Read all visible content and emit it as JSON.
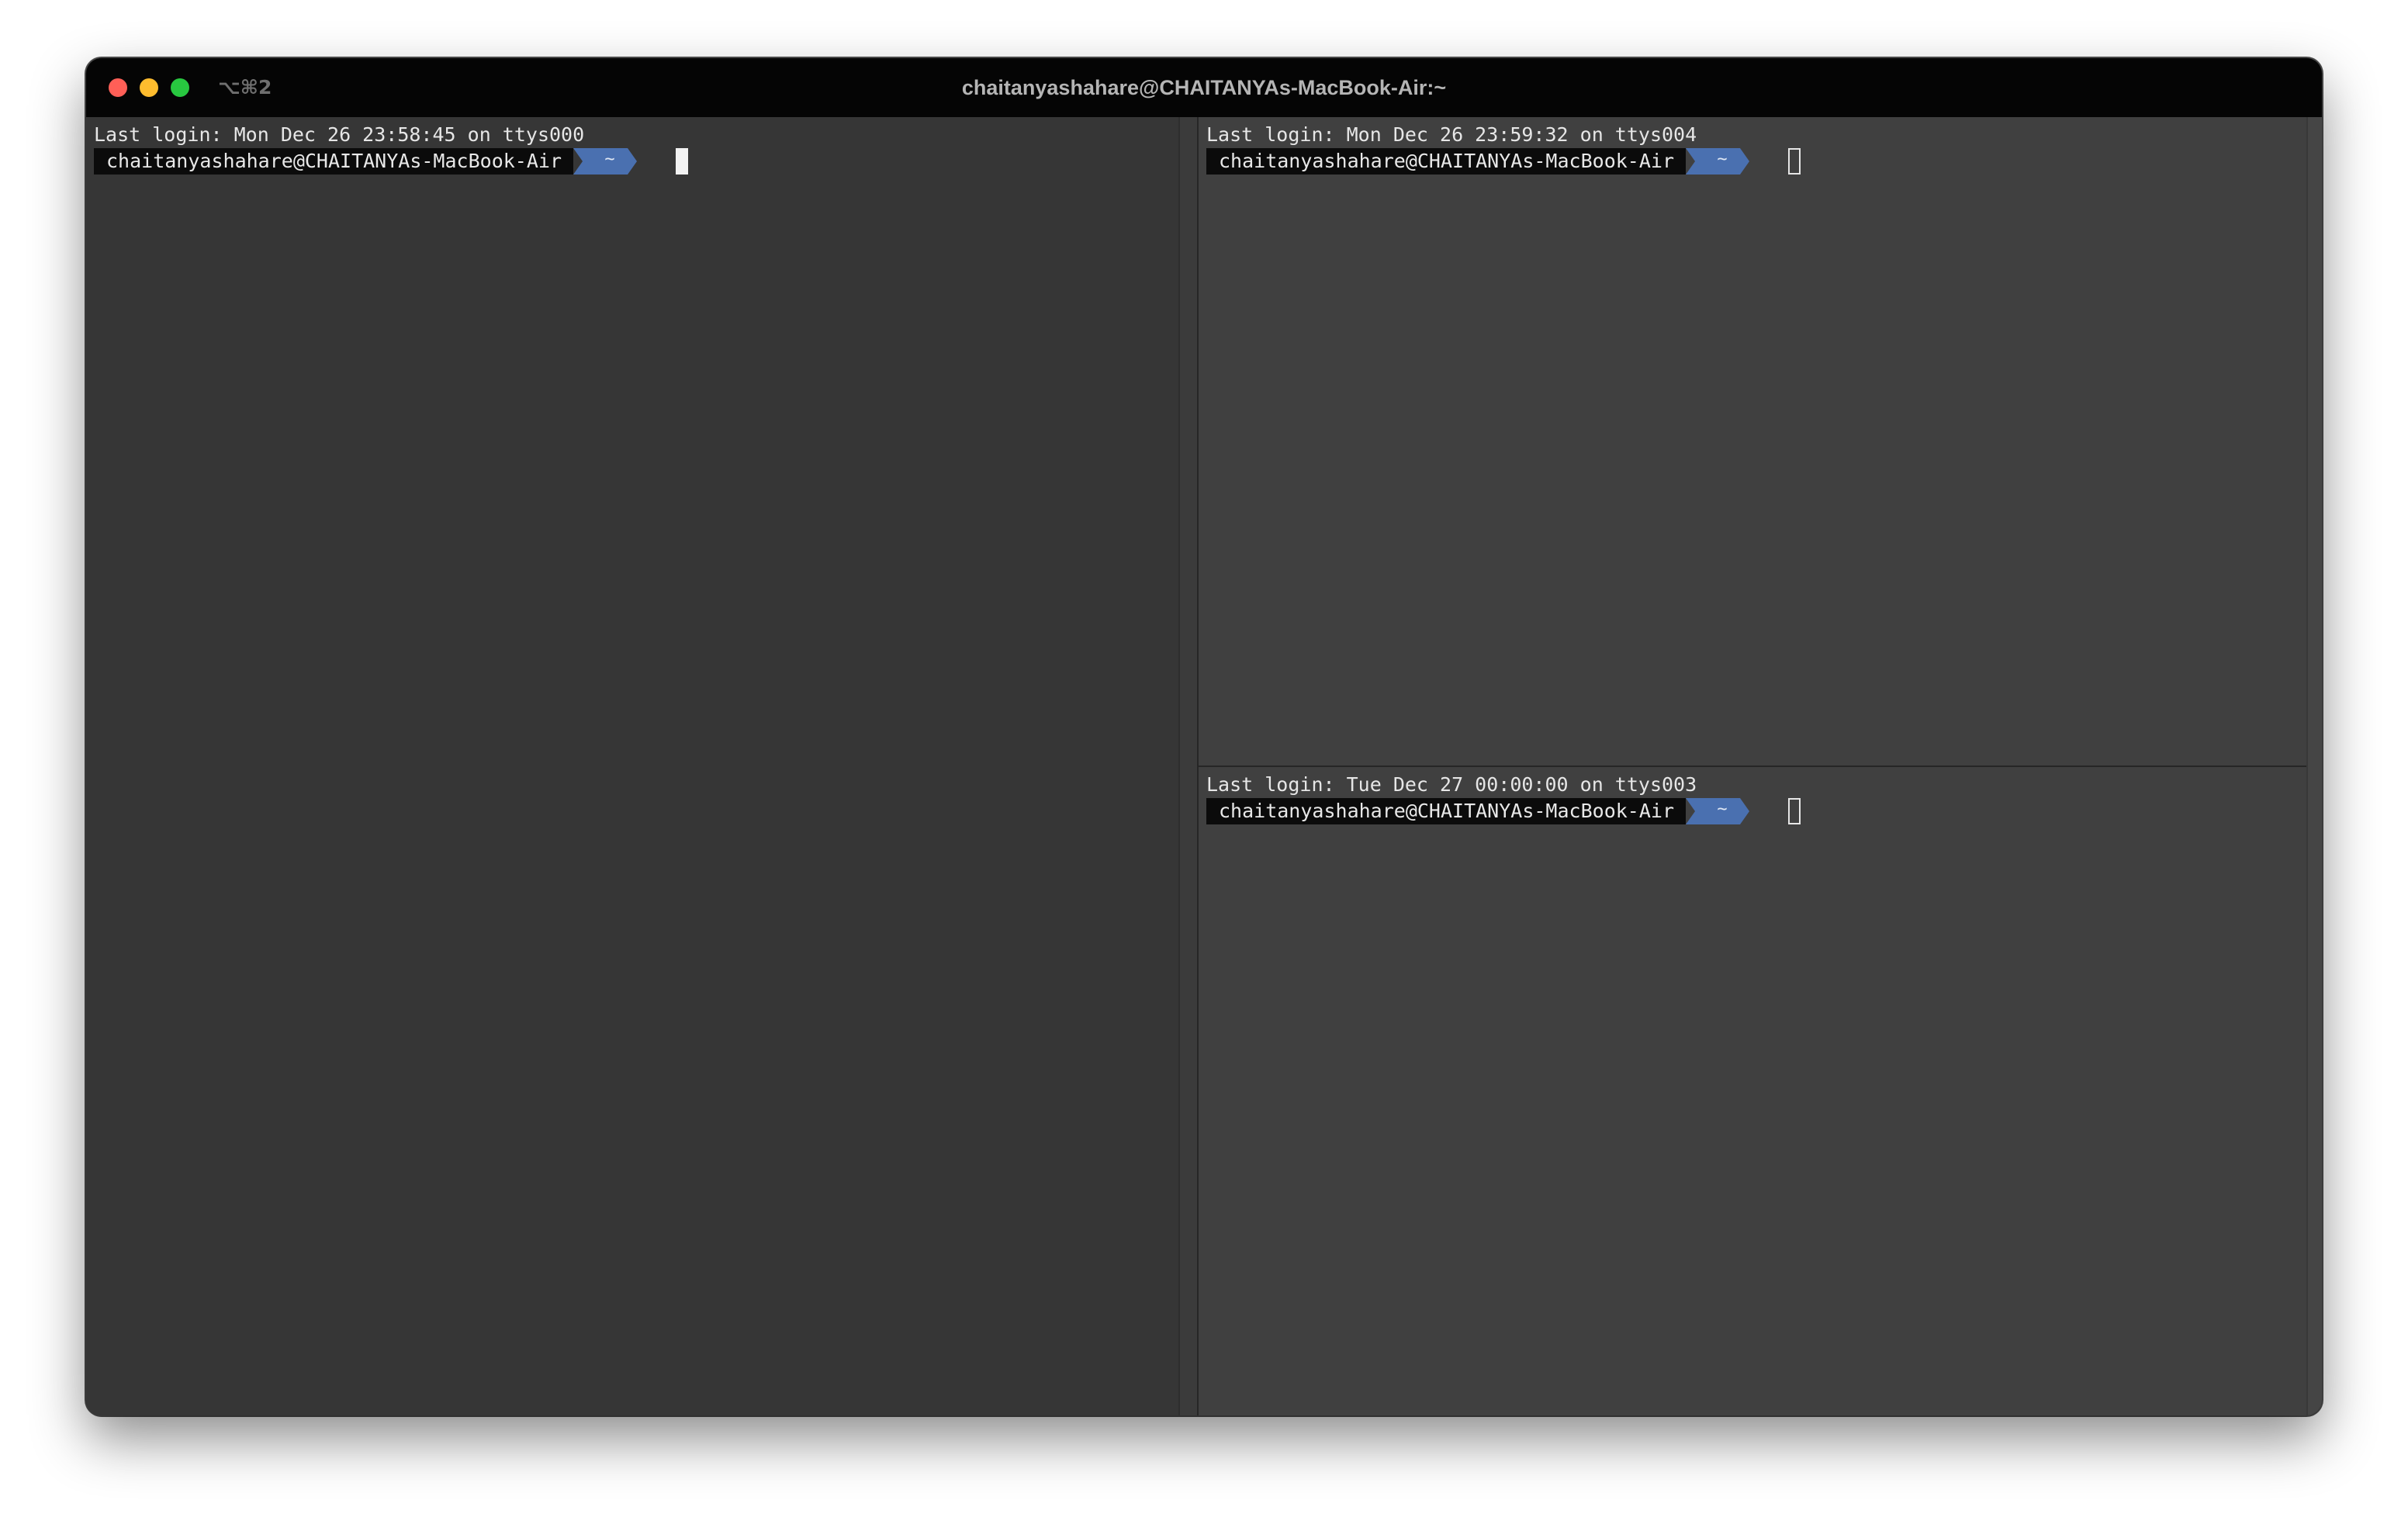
{
  "colors": {
    "close": "#ff5f57",
    "minimize": "#febc2e",
    "zoom": "#28c840",
    "titlebar": "#050505",
    "pane_active": "#363636",
    "pane_inactive": "#404040",
    "prompt_host_bg": "#0b0b0b",
    "prompt_dir_bg": "#4a70b0"
  },
  "window": {
    "shortcut": "⌥⌘2",
    "title": "chaitanyashahare@CHAITANYAs-MacBook-Air:~"
  },
  "panes": {
    "left": {
      "last_login": "Last login: Mon Dec 26 23:58:45 on ttys000",
      "host": "chaitanyashahare@CHAITANYAs-MacBook-Air",
      "dir": "~",
      "active": true
    },
    "top_right": {
      "last_login": "Last login: Mon Dec 26 23:59:32 on ttys004",
      "host": "chaitanyashahare@CHAITANYAs-MacBook-Air",
      "dir": "~",
      "active": false
    },
    "bottom_right": {
      "last_login": "Last login: Tue Dec 27 00:00:00 on ttys003",
      "host": "chaitanyashahare@CHAITANYAs-MacBook-Air",
      "dir": "~",
      "active": false
    }
  }
}
